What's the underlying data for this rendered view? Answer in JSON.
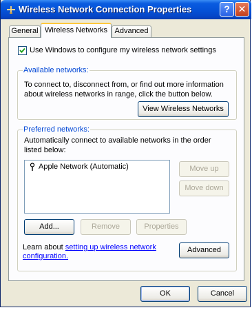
{
  "window": {
    "title": "Wireless Network Connection Properties",
    "help_label": "?",
    "close_label": "✕"
  },
  "tabs": [
    {
      "label": "General",
      "active": false
    },
    {
      "label": "Wireless Networks",
      "active": true
    },
    {
      "label": "Advanced",
      "active": false
    }
  ],
  "use_windows": {
    "label": "Use Windows to configure my wireless network settings",
    "checked": true
  },
  "available": {
    "legend": "Available networks:",
    "description": "To connect to, disconnect from, or find out more information about wireless networks in range, click the button below.",
    "view_button": "View Wireless Networks"
  },
  "preferred": {
    "legend": "Preferred networks:",
    "description": "Automatically connect to available networks in the order listed below:",
    "networks": [
      "Apple Network (Automatic)"
    ],
    "move_up": "Move up",
    "move_down": "Move down",
    "add": "Add...",
    "remove": "Remove",
    "properties": "Properties"
  },
  "learn": {
    "prefix": "Learn about ",
    "link": "setting up wireless network configuration.",
    "advanced": "Advanced"
  },
  "footer": {
    "ok": "OK",
    "cancel": "Cancel"
  },
  "colors": {
    "title_bar": "#0553d8",
    "group_legend": "#0046d5",
    "link": "#0000ff"
  }
}
